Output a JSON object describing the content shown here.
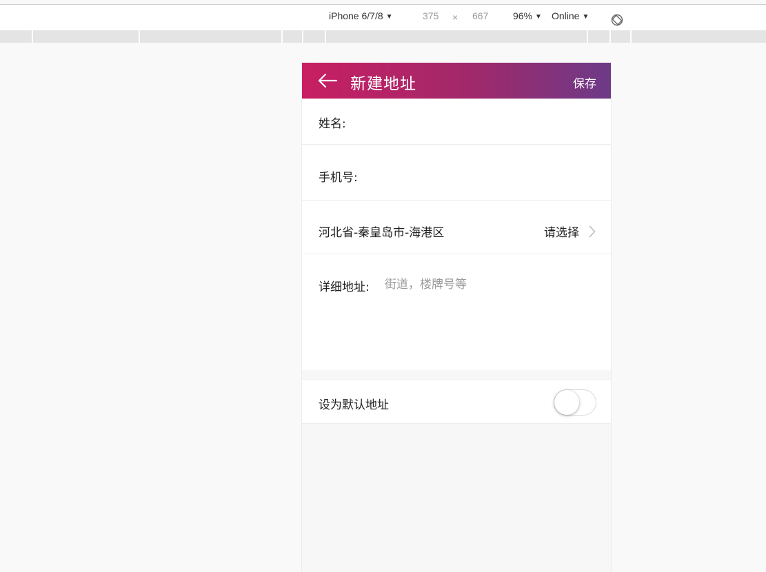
{
  "devtools": {
    "device": "iPhone 6/7/8",
    "width": "375",
    "times": "×",
    "height": "667",
    "zoom": "96%",
    "network": "Online"
  },
  "appbar": {
    "title": "新建地址",
    "save_label": "保存"
  },
  "form": {
    "name_label": "姓名:",
    "name_value": "",
    "phone_label": "手机号:",
    "phone_value": "",
    "region_value": "河北省-秦皇岛市-海港区",
    "region_select_label": "请选择",
    "detail_label": "详细地址:",
    "detail_placeholder": "街道，楼牌号等",
    "default_label": "设为默认地址",
    "default_on": false
  },
  "colors": {
    "header_gradient_start": "#c81e62",
    "header_gradient_end": "#6c3a88"
  }
}
